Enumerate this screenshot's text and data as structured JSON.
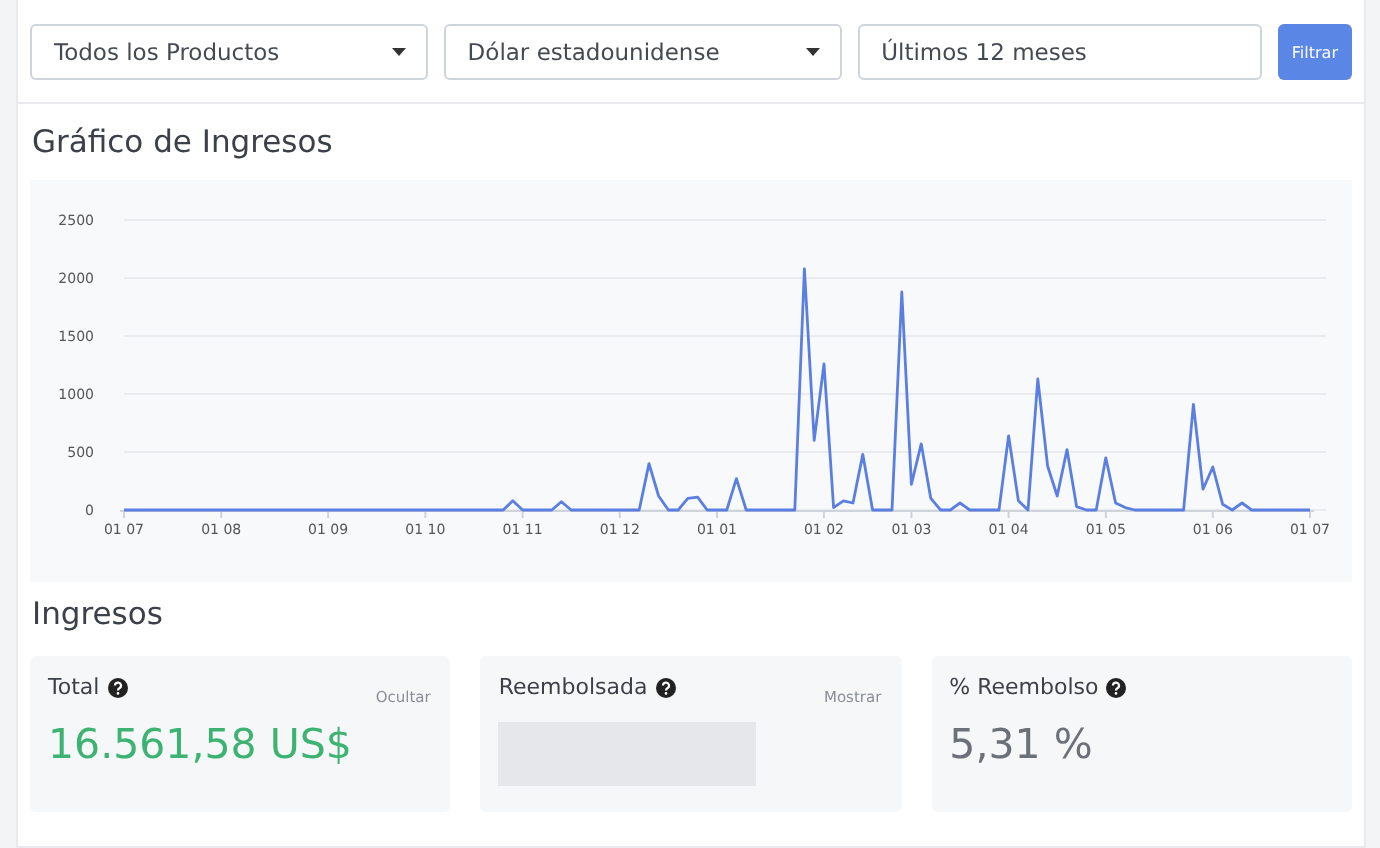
{
  "filters": [
    {
      "kind": "select",
      "value": "Todos los Productos"
    },
    {
      "kind": "select",
      "value": "Dólar estadounidense"
    },
    {
      "kind": "input",
      "value": "Últimos 12 meses"
    }
  ],
  "filter_button": "Filtrar",
  "revenue_chart": {
    "title": "Gráfico de Ingresos",
    "chart_data": {
      "type": "line",
      "grid": true,
      "ylim": [
        0,
        2500
      ],
      "yticks": [
        0,
        500,
        1000,
        1500,
        2000,
        2500
      ],
      "categories": [
        "01 07",
        null,
        null,
        null,
        null,
        null,
        null,
        null,
        null,
        null,
        "01 08",
        null,
        null,
        null,
        null,
        null,
        null,
        null,
        null,
        null,
        null,
        "01 09",
        null,
        null,
        null,
        null,
        null,
        null,
        null,
        null,
        null,
        "01 10",
        null,
        null,
        null,
        null,
        null,
        null,
        null,
        null,
        null,
        "01 11",
        null,
        null,
        null,
        null,
        null,
        null,
        null,
        null,
        null,
        "01 12",
        null,
        null,
        null,
        null,
        null,
        null,
        null,
        null,
        null,
        "01 01",
        null,
        null,
        null,
        null,
        null,
        null,
        null,
        null,
        null,
        null,
        "01 02",
        null,
        null,
        null,
        null,
        null,
        null,
        null,
        null,
        "01 03",
        null,
        null,
        null,
        null,
        null,
        null,
        null,
        null,
        null,
        "01 04",
        null,
        null,
        null,
        null,
        null,
        null,
        null,
        null,
        null,
        "01 05",
        null,
        null,
        null,
        null,
        null,
        null,
        null,
        null,
        null,
        null,
        "01 06",
        null,
        null,
        null,
        null,
        null,
        null,
        null,
        null,
        null,
        "01 07"
      ],
      "series": [
        {
          "color": "#5b7fe0",
          "values": [
            0,
            0,
            0,
            0,
            0,
            0,
            0,
            0,
            0,
            0,
            0,
            0,
            0,
            0,
            0,
            0,
            0,
            0,
            0,
            0,
            0,
            0,
            0,
            0,
            0,
            0,
            0,
            0,
            0,
            0,
            0,
            0,
            0,
            0,
            0,
            0,
            0,
            0,
            0,
            0,
            80,
            0,
            0,
            0,
            0,
            70,
            0,
            0,
            0,
            0,
            0,
            0,
            0,
            0,
            400,
            120,
            0,
            0,
            100,
            110,
            0,
            0,
            0,
            270,
            0,
            0,
            0,
            0,
            0,
            0,
            2080,
            600,
            1260,
            20,
            80,
            60,
            480,
            0,
            0,
            0,
            1880,
            220,
            570,
            100,
            0,
            0,
            60,
            0,
            0,
            0,
            0,
            640,
            80,
            0,
            1130,
            380,
            120,
            520,
            30,
            0,
            0,
            450,
            60,
            20,
            0,
            0,
            0,
            0,
            0,
            0,
            910,
            180,
            370,
            50,
            0,
            60,
            0,
            0,
            0,
            0,
            0,
            0,
            0
          ]
        }
      ]
    }
  },
  "revenue": {
    "title": "Ingresos",
    "cards": [
      {
        "kind": "amount",
        "label": "Total",
        "toggle": "Ocultar",
        "value": "16.561,58 US$"
      },
      {
        "kind": "masked",
        "label": "Reembolsada",
        "toggle": "Mostrar"
      },
      {
        "kind": "plain",
        "label": "% Reembolso",
        "value": "5,31 %"
      }
    ]
  }
}
